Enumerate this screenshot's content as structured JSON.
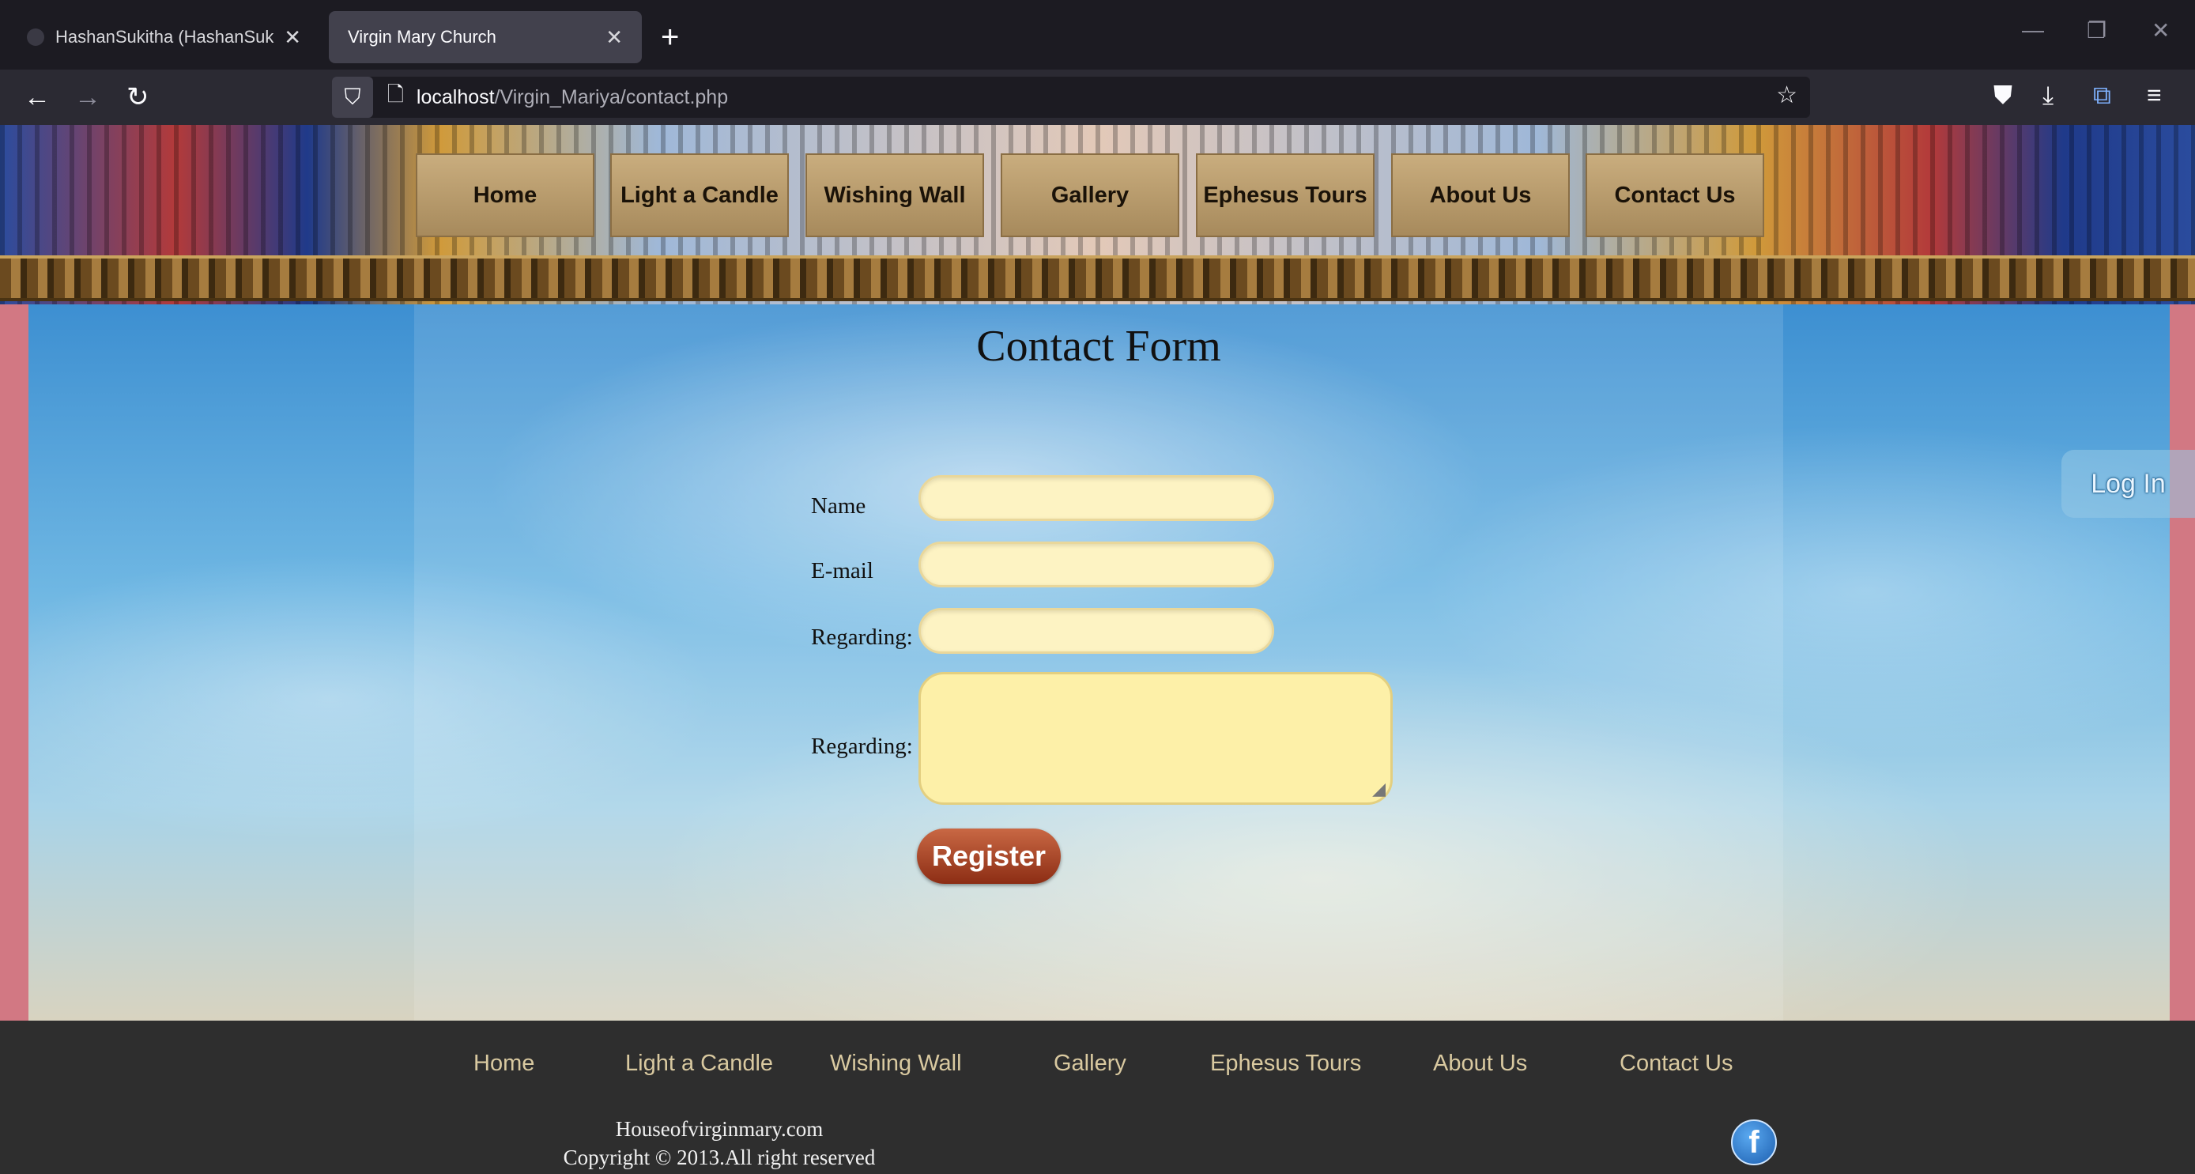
{
  "browser": {
    "tabs": [
      {
        "title": "HashanSukitha (HashanSukitha)",
        "close": "✕"
      },
      {
        "title": "Virgin Mary Church",
        "close": "✕"
      }
    ],
    "new_tab": "+",
    "url_host": "localhost",
    "url_path": "/Virgin_Mariya/contact.php",
    "window_controls": {
      "minimize": "—",
      "restore": "❐",
      "close": "✕"
    },
    "nav": {
      "back": "←",
      "forward": "→",
      "reload": "↻"
    },
    "icons": [
      "shield-icon",
      "page-icon",
      "star-icon",
      "pocket-icon",
      "download-icon",
      "translate-icon",
      "menu-icon"
    ]
  },
  "site": {
    "top_nav": [
      "Home",
      "Light a Candle",
      "Wishing Wall",
      "Gallery",
      "Ephesus Tours",
      "About Us",
      "Contact Us"
    ],
    "form": {
      "title": "Contact Form",
      "labels": {
        "name": "Name",
        "email": "E-mail",
        "regarding": "Regarding:",
        "message": "Regarding:"
      },
      "values": {
        "name": "",
        "email": "",
        "regarding": "",
        "message": ""
      },
      "submit": "Register"
    },
    "login_label": "Log In",
    "footer": {
      "nav": [
        "Home",
        "Light a Candle",
        "Wishing Wall",
        "Gallery",
        "Ephesus Tours",
        "About Us",
        "Contact Us"
      ],
      "site_name": "Houseofvirginmary.com",
      "copyright": "Copyright © 2013.All right reserved",
      "social_icon": "f"
    },
    "colors": {
      "input_bg": "#fdf3c3",
      "button": "#a8442a",
      "footer_bg": "#2e2e2e",
      "footer_link": "#d9c9a0"
    }
  }
}
